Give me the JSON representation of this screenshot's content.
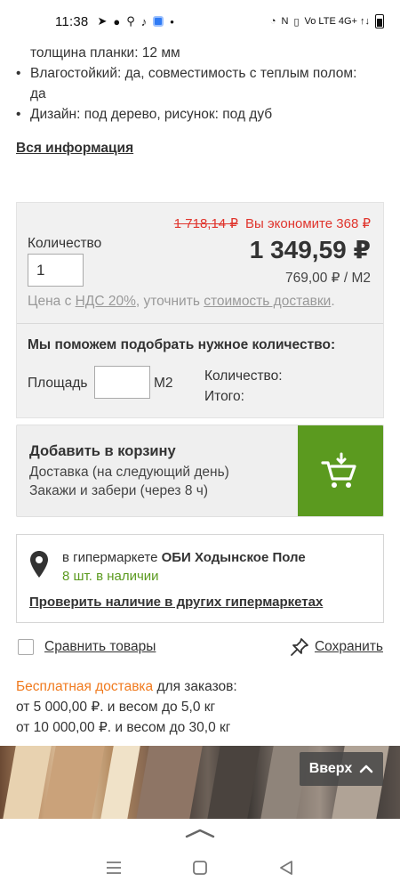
{
  "status_bar": {
    "time": "11:38",
    "indicators": "Vo LTE 4G+ ↑↓"
  },
  "specs": {
    "items": [
      {
        "text": "толщина планки: 12 мм",
        "bullet": false
      },
      {
        "text": "Влагостойкий: да, совместимость с теплым полом:",
        "bullet": true
      },
      {
        "text": "да",
        "bullet": false
      },
      {
        "text": "Дизайн: под дерево, рисунок: под дуб",
        "bullet": true
      }
    ],
    "all_info_link": "Вся информация"
  },
  "price_box": {
    "old_price": "1 718,14 ₽",
    "economy_text": "Вы экономите 368 ₽",
    "quantity_label": "Количество",
    "quantity_value": "1",
    "price": "1 349,59 ₽",
    "unit_price": "769,00 ₽ / М2",
    "vat_prefix": "Цена с ",
    "vat_link": "НДС 20%",
    "vat_middle": ", уточнить ",
    "delivery_cost_link": "стоимость доставки",
    "vat_suffix": ".",
    "help_title": "Мы поможем подобрать нужное количество:",
    "area_label": "Площадь",
    "area_unit": "М2",
    "count_label": "Количество:",
    "total_label": "Итого:"
  },
  "cart": {
    "title": "Добавить в корзину",
    "line1": "Доставка (на следующий день)",
    "line2": "Закажи и забери (через 8 ч)",
    "button_color": "#5b9a1f"
  },
  "store": {
    "prefix": "в гипермаркете ",
    "name": "ОБИ Ходынское Поле",
    "stock": "8 шт. в наличии",
    "check_link": "Проверить наличие в других гипермаркетах"
  },
  "actions": {
    "compare_label": "Сравнить товары",
    "save_label": "Сохранить"
  },
  "delivery": {
    "free_label": "Бесплатная доставка",
    "line1_rest": " для заказов:",
    "line2": "от 5 000,00 ₽. и весом до 5,0 кг",
    "line3": "от 10 000,00 ₽. и весом до 30,0 кг"
  },
  "scroll_top": {
    "label": "Вверх"
  },
  "colors": {
    "accent_green": "#5b9a1f",
    "accent_orange": "#f07a1e",
    "discount_red": "#e0342c"
  }
}
